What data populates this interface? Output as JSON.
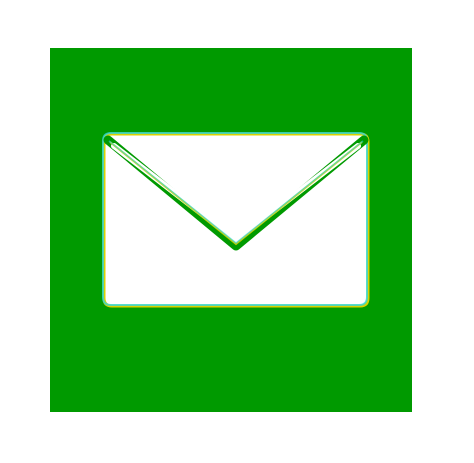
{
  "app": {
    "icon_name": "envelope-icon",
    "tile_color": "#009a00",
    "glyph_color": "#ffffff"
  }
}
